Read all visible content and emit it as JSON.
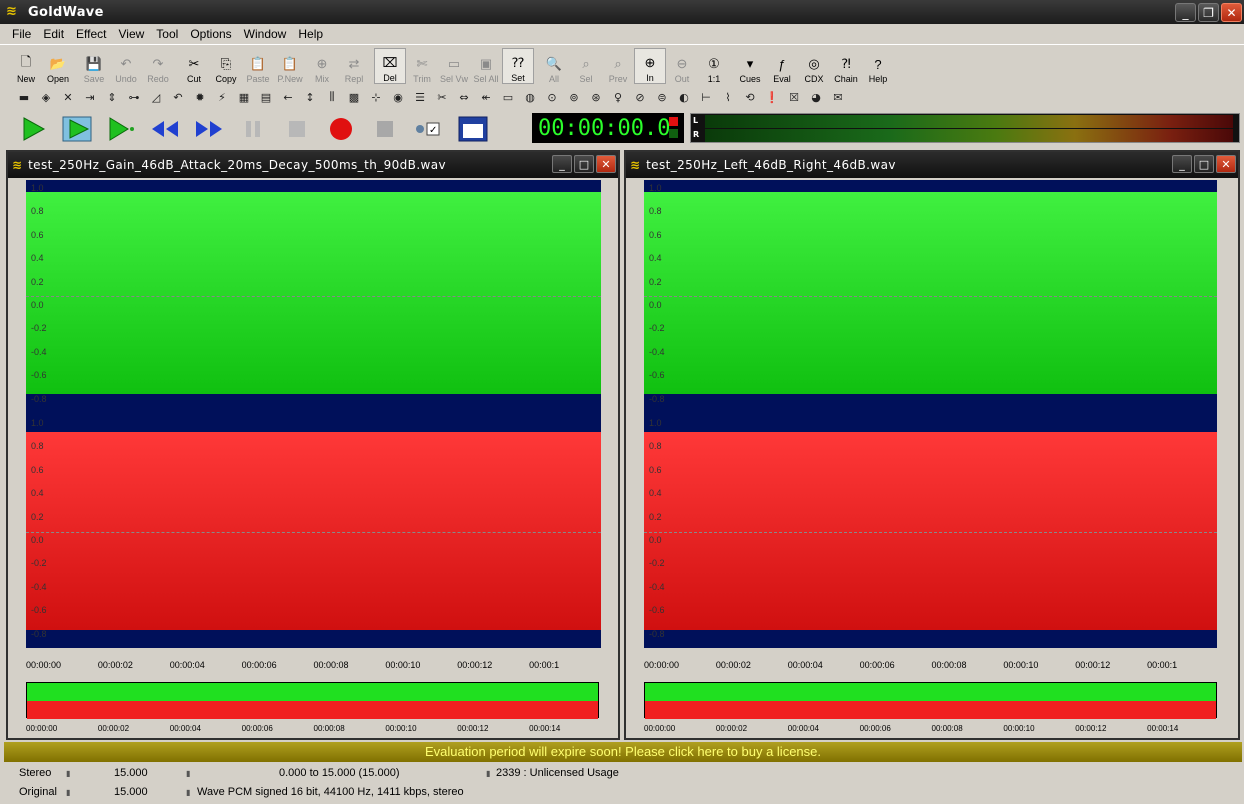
{
  "app": {
    "title": "GoldWave"
  },
  "menu": [
    "File",
    "Edit",
    "Effect",
    "View",
    "Tool",
    "Options",
    "Window",
    "Help"
  ],
  "toolbar": [
    {
      "label": "New",
      "icon": "new-file-icon",
      "enabled": true
    },
    {
      "label": "Open",
      "icon": "open-folder-icon",
      "enabled": true
    },
    {
      "label": "Save",
      "icon": "save-icon",
      "enabled": false
    },
    {
      "label": "Undo",
      "icon": "undo-icon",
      "enabled": false
    },
    {
      "label": "Redo",
      "icon": "redo-icon",
      "enabled": false
    },
    {
      "label": "Cut",
      "icon": "scissors-icon",
      "enabled": true
    },
    {
      "label": "Copy",
      "icon": "copy-icon",
      "enabled": true
    },
    {
      "label": "Paste",
      "icon": "paste-icon",
      "enabled": false
    },
    {
      "label": "P.New",
      "icon": "paste-new-icon",
      "enabled": false
    },
    {
      "label": "Mix",
      "icon": "mix-icon",
      "enabled": false
    },
    {
      "label": "Repl",
      "icon": "replace-icon",
      "enabled": false
    },
    {
      "label": "Del",
      "icon": "delete-icon",
      "enabled": true
    },
    {
      "label": "Trim",
      "icon": "trim-icon",
      "enabled": false
    },
    {
      "label": "Sel Vw",
      "icon": "select-view-icon",
      "enabled": false
    },
    {
      "label": "Sel All",
      "icon": "select-all-icon",
      "enabled": false
    },
    {
      "label": "Set",
      "icon": "set-marker-icon",
      "enabled": true
    },
    {
      "label": "All",
      "icon": "zoom-all-icon",
      "enabled": false
    },
    {
      "label": "Sel",
      "icon": "zoom-selection-icon",
      "enabled": false
    },
    {
      "label": "Prev",
      "icon": "zoom-prev-icon",
      "enabled": false
    },
    {
      "label": "In",
      "icon": "zoom-in-icon",
      "enabled": true
    },
    {
      "label": "Out",
      "icon": "zoom-out-icon",
      "enabled": false
    },
    {
      "label": "1:1",
      "icon": "zoom-1-1-icon",
      "enabled": true
    },
    {
      "label": "Cues",
      "icon": "cues-icon",
      "enabled": true
    },
    {
      "label": "Eval",
      "icon": "eval-icon",
      "enabled": true
    },
    {
      "label": "CDX",
      "icon": "cd-icon",
      "enabled": true
    },
    {
      "label": "Chain",
      "icon": "chain-icon",
      "enabled": true
    },
    {
      "label": "Help",
      "icon": "help-icon",
      "enabled": true
    }
  ],
  "transport": {
    "time": "00:00:00.0"
  },
  "vu": {
    "left_label": "L",
    "right_label": "R"
  },
  "colors": {
    "left_channel": "#20e020",
    "right_channel": "#f02020",
    "wave_bg": "#00105a",
    "eval_text": "#ffff70"
  },
  "docs": [
    {
      "name": "test_250Hz_Gain_46dB_Attack_20ms_Decay_500ms_th_90dB.wav",
      "left_scale": [
        "1.0",
        "0.8",
        "0.6",
        "0.4",
        "0.2",
        "0.0",
        "-0.2",
        "-0.4",
        "-0.6",
        "-0.8"
      ],
      "right_scale": [
        "1.0",
        "0.8",
        "0.6",
        "0.4",
        "0.2",
        "0.0",
        "-0.2",
        "-0.4",
        "-0.6",
        "-0.8"
      ],
      "timeline": [
        "00:00:00",
        "00:00:02",
        "00:00:04",
        "00:00:06",
        "00:00:08",
        "00:00:10",
        "00:00:12",
        "00:00:1"
      ],
      "overview_timeline": [
        "00:00:00",
        "00:00:02",
        "00:00:04",
        "00:00:06",
        "00:00:08",
        "00:00:10",
        "00:00:12",
        "00:00:14"
      ]
    },
    {
      "name": "test_250Hz_Left_46dB_Right_46dB.wav",
      "left_scale": [
        "1.0",
        "0.8",
        "0.6",
        "0.4",
        "0.2",
        "0.0",
        "-0.2",
        "-0.4",
        "-0.6",
        "-0.8"
      ],
      "right_scale": [
        "1.0",
        "0.8",
        "0.6",
        "0.4",
        "0.2",
        "0.0",
        "-0.2",
        "-0.4",
        "-0.6",
        "-0.8"
      ],
      "timeline": [
        "00:00:00",
        "00:00:02",
        "00:00:04",
        "00:00:06",
        "00:00:08",
        "00:00:10",
        "00:00:12",
        "00:00:1"
      ],
      "overview_timeline": [
        "00:00:00",
        "00:00:02",
        "00:00:04",
        "00:00:06",
        "00:00:08",
        "00:00:10",
        "00:00:12",
        "00:00:14"
      ]
    }
  ],
  "eval_message": "Evaluation period will expire soon! Please click here to buy a license.",
  "status": {
    "row1": {
      "channels": "Stereo",
      "length": "15.000",
      "selection": "0.000 to 15.000 (15.000)",
      "usage": "2339 : Unlicensed Usage"
    },
    "row2": {
      "mode": "Original",
      "length": "15.000",
      "format": "Wave PCM signed 16 bit, 44100 Hz, 1411 kbps, stereo"
    }
  }
}
